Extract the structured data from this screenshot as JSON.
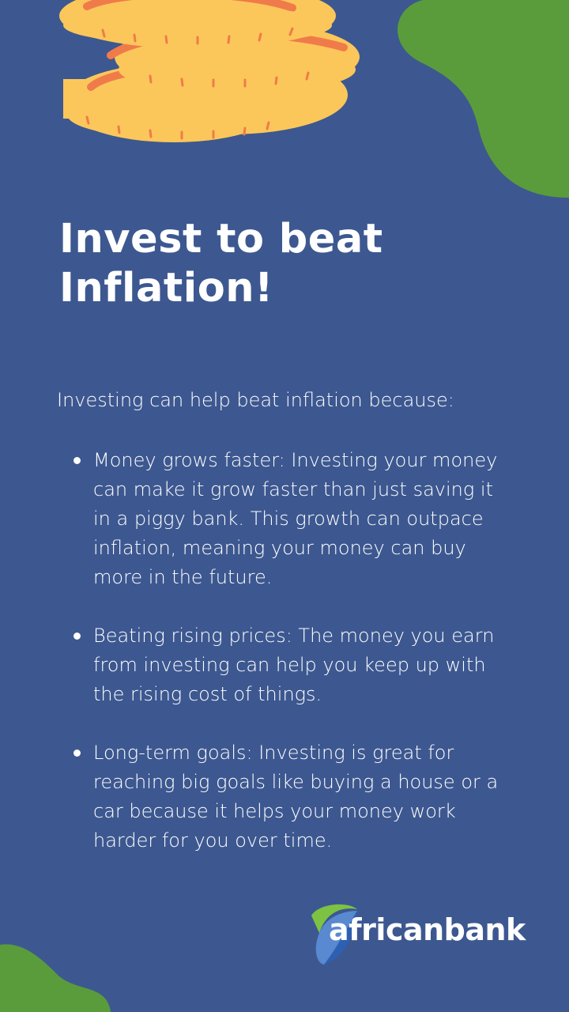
{
  "colors": {
    "background": "#3d5890",
    "accent_green": "#5a9c3c",
    "coin_gold": "#fcc75a",
    "coin_orange": "#f07b4a",
    "text": "#ffffff"
  },
  "hero": {
    "title": "Invest to beat Inflation!",
    "illustration": "stacked-gold-coins"
  },
  "content": {
    "intro": "Investing can help beat inflation because:",
    "reasons": [
      "Money grows faster: Investing your money can make it grow faster than just saving it in a piggy bank. This growth can outpace inflation, meaning your money can buy more in the future.",
      "Beating rising prices: The money you earn from investing can help you keep up with the rising cost of things.",
      "Long-term goals: Investing is great for reaching big goals like buying a house or a car because it helps your money work harder for you over time."
    ]
  },
  "brand": {
    "name": "africanbank",
    "logo_icon": "africanbank-logo-mark"
  }
}
